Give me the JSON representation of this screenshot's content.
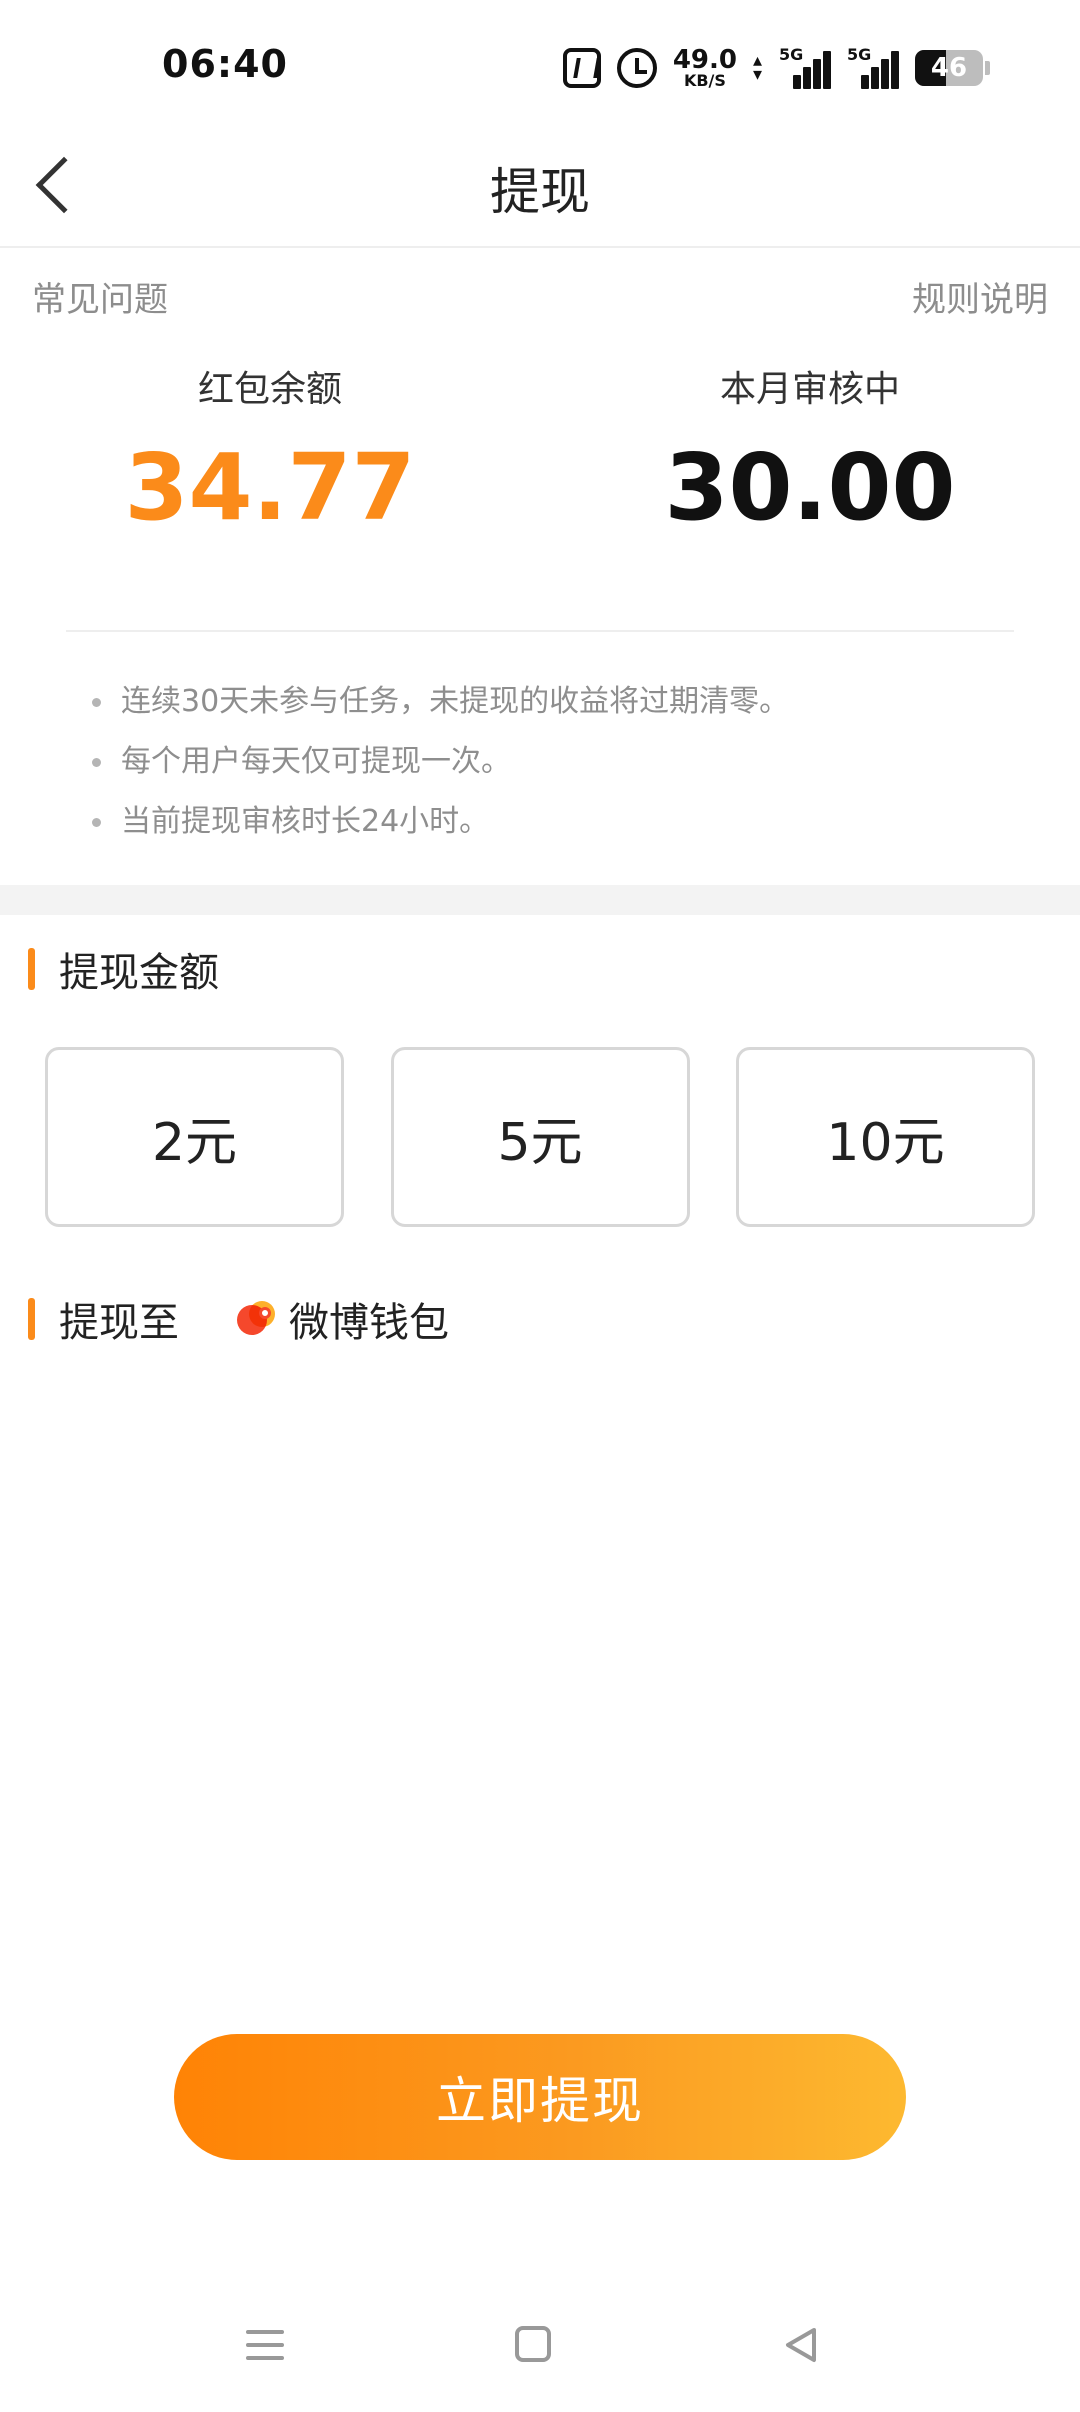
{
  "status_bar": {
    "time": "06:40",
    "net_speed_value": "49.0",
    "net_speed_unit": "KB/S",
    "signal_1_label": "5G",
    "signal_2_label": "5G",
    "battery_level": "46",
    "icons": [
      "nfc-icon",
      "alarm-icon",
      "updown-arrows-icon",
      "signal-icon",
      "signal-icon",
      "battery-icon"
    ]
  },
  "nav": {
    "title": "提现",
    "back_icon": "chevron-left-icon"
  },
  "links": {
    "faq": "常见问题",
    "rules": "规则说明"
  },
  "balance": {
    "red_packet_label": "红包余额",
    "red_packet_value": "34.77",
    "reviewing_label": "本月审核中",
    "reviewing_value": "30.00"
  },
  "notes": [
    "连续30天未参与任务，未提现的收益将过期清零。",
    "每个用户每天仅可提现一次。",
    "当前提现审核时长24小时。"
  ],
  "withdraw_amount": {
    "title": "提现金额",
    "options": [
      "2元",
      "5元",
      "10元"
    ]
  },
  "withdraw_to": {
    "title": "提现至",
    "wallet_label": "微博钱包",
    "wallet_icon": "weibo-wallet-icon"
  },
  "withdraw_button": "立即提现",
  "colors": {
    "accent": "#fb8b1a",
    "button_gradient_start": "#ff8305",
    "button_gradient_end": "#fdb930"
  },
  "system_nav_icons": [
    "menu-icon",
    "home-icon",
    "back-triangle-icon"
  ]
}
